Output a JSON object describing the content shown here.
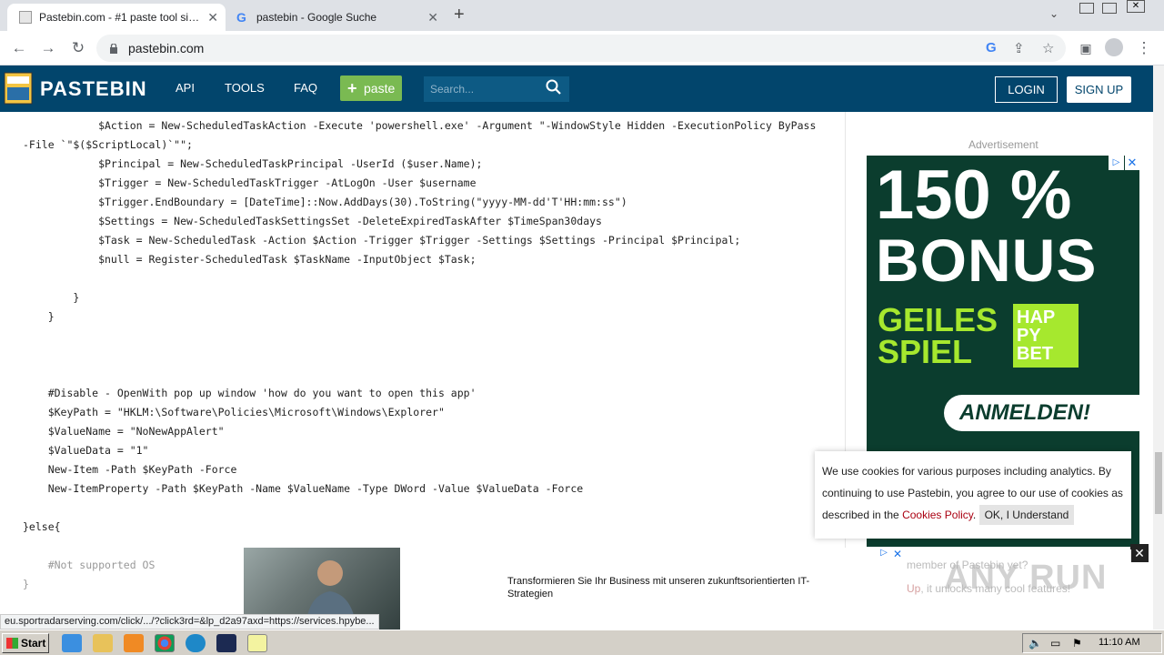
{
  "browser": {
    "tabs": [
      {
        "title": "Pastebin.com - #1 paste tool since 2002!",
        "active": true
      },
      {
        "title": "pastebin - Google Suche",
        "active": false
      }
    ],
    "url": "pastebin.com"
  },
  "header": {
    "brand": "PASTEBIN",
    "nav": [
      "API",
      "TOOLS",
      "FAQ"
    ],
    "paste_label": "paste",
    "search_placeholder": "Search...",
    "login_label": "LOGIN",
    "signup_label": "SIGN UP"
  },
  "code": {
    "lines": [
      "            $Action = New-ScheduledTaskAction -Execute 'powershell.exe' -Argument \"-WindowStyle Hidden -ExecutionPolicy ByPass",
      "-File `\"$($ScriptLocal)`\"\";",
      "            $Principal = New-ScheduledTaskPrincipal -UserId ($user.Name);",
      "            $Trigger = New-ScheduledTaskTrigger -AtLogOn -User $username",
      "            $Trigger.EndBoundary = [DateTime]::Now.AddDays(30).ToString(\"yyyy-MM-dd'T'HH:mm:ss\")",
      "            $Settings = New-ScheduledTaskSettingsSet -DeleteExpiredTaskAfter $TimeSpan30days",
      "            $Task = New-ScheduledTask -Action $Action -Trigger $Trigger -Settings $Settings -Principal $Principal;",
      "            $null = Register-ScheduledTask $TaskName -InputObject $Task;",
      "",
      "        }",
      "    }",
      "",
      "",
      "",
      "    #Disable - OpenWith pop up window 'how do you want to open this app'",
      "    $KeyPath = \"HKLM:\\Software\\Policies\\Microsoft\\Windows\\Explorer\"",
      "    $ValueName = \"NoNewAppAlert\"",
      "    $ValueData = \"1\"",
      "    New-Item -Path $KeyPath -Force",
      "    New-ItemProperty -Path $KeyPath -Name $ValueName -Type DWord -Value $ValueData -Force",
      "",
      "}else{",
      "",
      "    #Not supported OS",
      "}"
    ]
  },
  "sidebar": {
    "ad_label": "Advertisement",
    "ad": {
      "line1": "150 %",
      "line2": "BONUS",
      "green1": "GEILES",
      "green2": "SPIEL",
      "brand": "HAP\nPY\nBET",
      "cta": "ANMELDEN!"
    }
  },
  "cookie": {
    "text": "We use cookies for various purposes including analytics. By continuing to use Pastebin, you agree to our use of cookies as described in the",
    "link": "Cookies Policy",
    "button": "OK, I Understand"
  },
  "bottom_ad": {
    "text": "Transformieren Sie Ihr Business mit unseren zukunftsorientierten IT-Strategien"
  },
  "watermark": {
    "line1": "member of Pastebin yet?",
    "line2_red": "Up",
    "line2": ", it unlocks many cool features!",
    "brand": "ANY RUN"
  },
  "status_url": "eu.sportradarserving.com/click/.../?click3rd=&lp_d2a97axd=https://services.hpybe...",
  "taskbar": {
    "start": "Start",
    "clock": "11:10 AM"
  },
  "colors": {
    "header_bg": "#02456c",
    "paste_btn": "#7aba52",
    "ad_green": "#a6e82e"
  }
}
